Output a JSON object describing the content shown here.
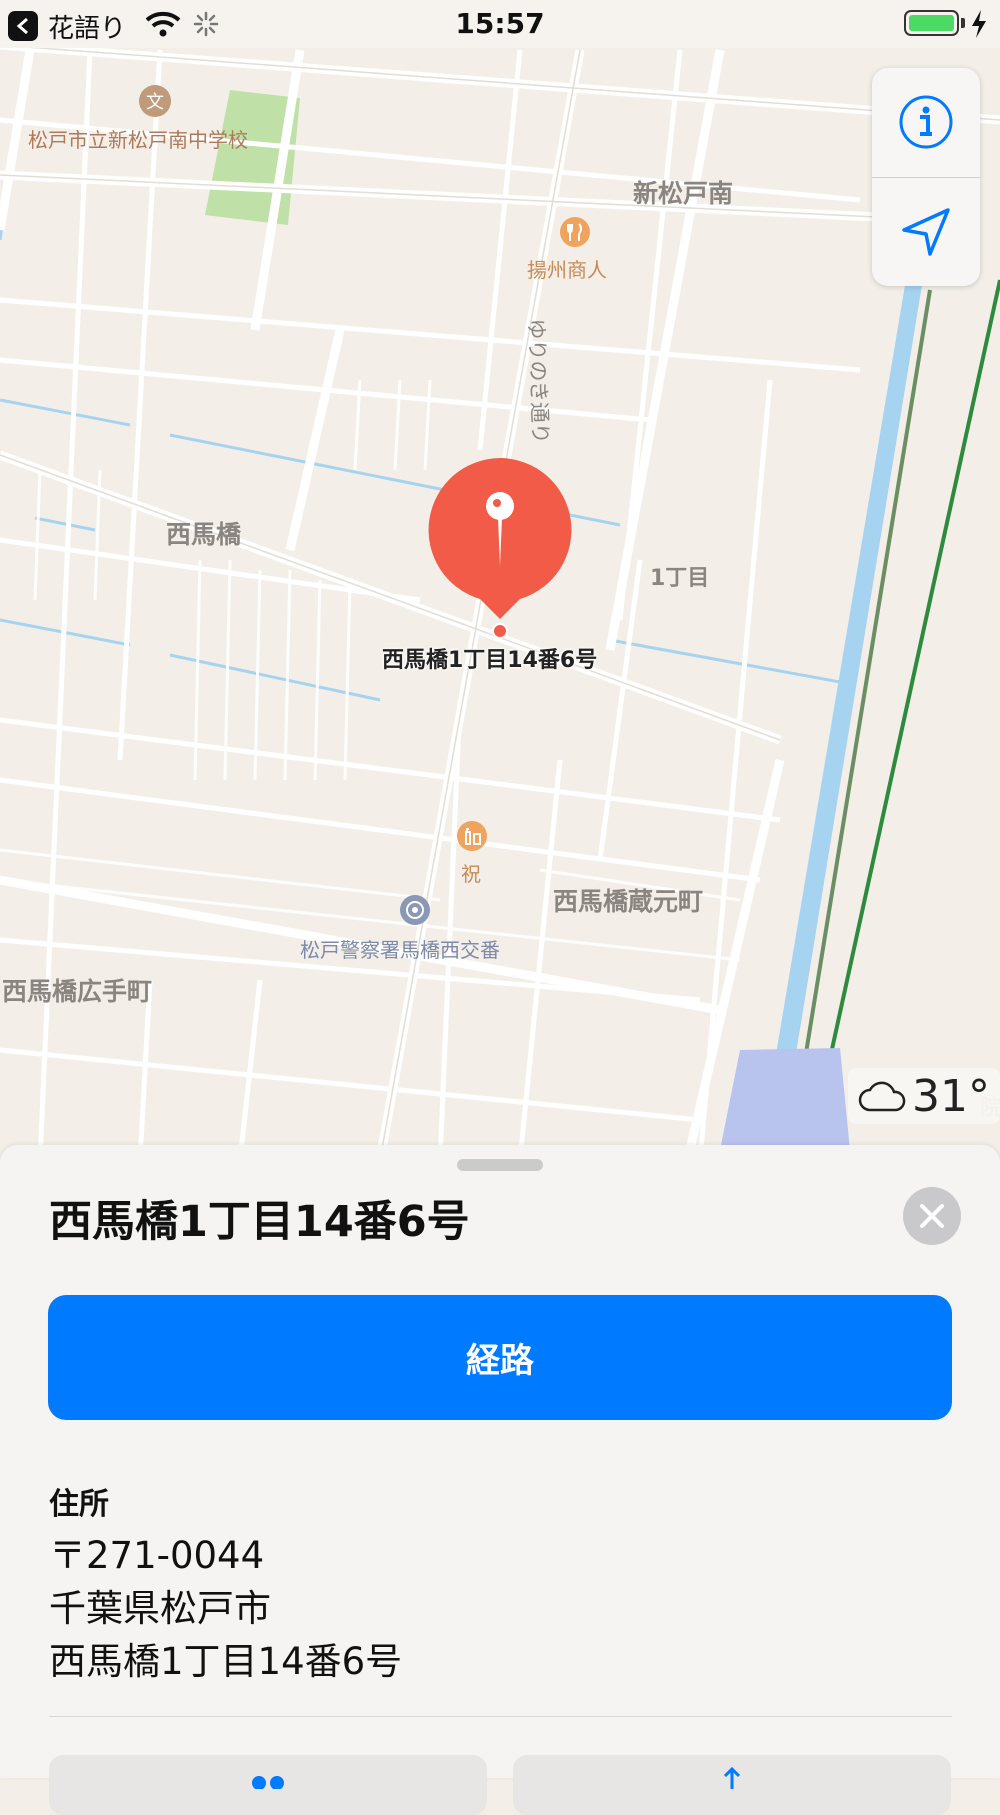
{
  "status_bar": {
    "back_app": "花語り",
    "time": "15:57",
    "battery_color": "#4cd964"
  },
  "map": {
    "labels": {
      "school": "松戸市立新松戸南中学校",
      "shinmatsudo_minami": "新松戸南",
      "restaurant": "揚州商人",
      "road": "ゆりのき通り",
      "nishimabashi": "西馬橋",
      "chome": "1丁目",
      "pin": "西馬橋1丁目14番6号",
      "liquor": "祝",
      "kuramoto": "西馬橋蔵元町",
      "police": "松戸警察署馬橋西交番",
      "hirotecho": "西馬橋広手町"
    },
    "icons": {
      "school": "school-icon",
      "restaurant": "fork-knife-icon",
      "liquor": "bottle-icon",
      "police": "police-icon",
      "pin": "map-pin-icon"
    },
    "weather": {
      "icon": "cloud-icon",
      "temp": "31°"
    },
    "controls": {
      "info": "info-icon",
      "location": "location-arrow-icon"
    }
  },
  "sheet": {
    "title": "西馬橋1丁目14番6号",
    "route_button": "経路",
    "address_label": "住所",
    "address_lines": [
      "〒271-0044",
      "千葉県松戸市",
      "西馬橋1丁目14番6号"
    ]
  },
  "colors": {
    "accent": "#007aff",
    "pin": "#f25b47",
    "rail": "#2e8b3e",
    "water": "#a6d3f0"
  }
}
